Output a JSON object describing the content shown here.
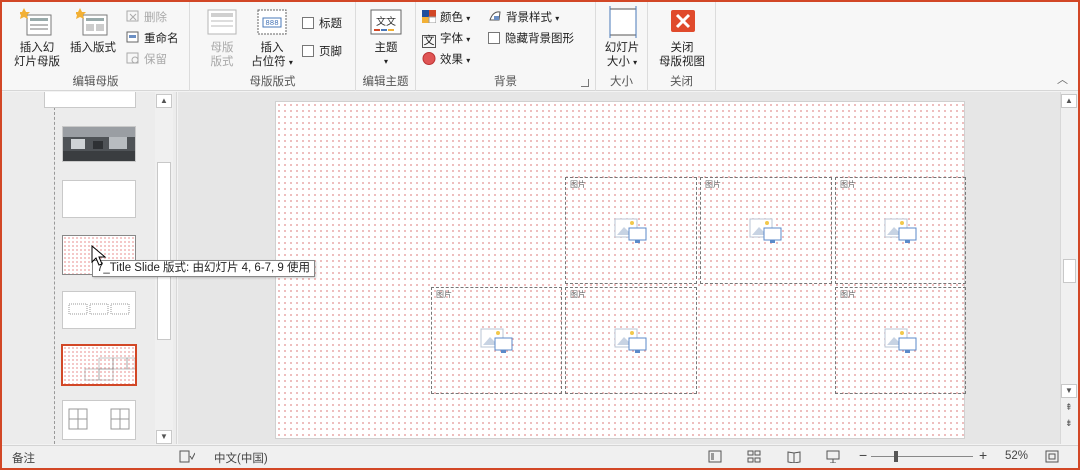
{
  "ribbon": {
    "edit_master": {
      "insert_master_l1": "插入幻",
      "insert_master_l2": "灯片母版",
      "insert_layout": "插入版式",
      "delete": "删除",
      "rename": "重命名",
      "preserve": "保留",
      "group_label": "编辑母版"
    },
    "master_layout": {
      "master_layout_l1": "母版",
      "master_layout_l2": "版式",
      "insert_ph_l1": "插入",
      "insert_ph_l2": "占位符",
      "title_check": "标题",
      "footer_check": "页脚",
      "group_label": "母版版式"
    },
    "edit_theme": {
      "themes": "主题",
      "theme_icon_text": "文文",
      "group_label": "编辑主题"
    },
    "background": {
      "colors": "颜色",
      "fonts": "字体",
      "effects": "效果",
      "bg_styles": "背景样式",
      "hide_bg": "隐藏背景图形",
      "font_icon_text": "文",
      "group_label": "背景"
    },
    "size": {
      "slide_size_l1": "幻灯片",
      "slide_size_l2": "大小",
      "group_label": "大小"
    },
    "close": {
      "close_l1": "关闭",
      "close_l2": "母版视图",
      "group_label": "关闭"
    }
  },
  "tooltip": "7_Title Slide 版式: 由幻灯片 4, 6-7, 9 使用",
  "placeholder_label": "图片",
  "status": {
    "notes": "备注",
    "language": "中文(中国)",
    "zoom": "52%",
    "zoom_minus": "−",
    "zoom_plus": "+"
  },
  "colors": {
    "accent": "#d24726",
    "close_red": "#e04a2c"
  }
}
